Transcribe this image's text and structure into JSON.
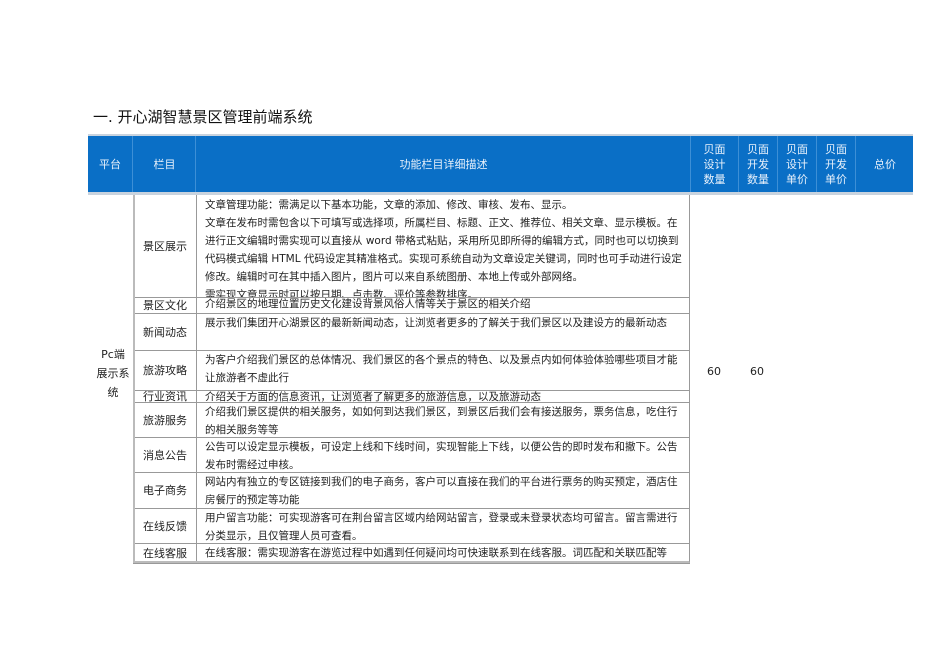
{
  "title": "一. 开心湖智慧景区管理前端系统",
  "header": [
    "平台",
    "栏目",
    "功能栏目详细描述",
    "贝面设计数量",
    "贝面开发数量",
    "贝面设计单价",
    "贝面开发单价",
    "总价"
  ],
  "platform": "Pc端展示系统",
  "design_qty": "60",
  "dev_qty": "60",
  "rows": [
    {
      "cat": "景区展示",
      "desc": "文章管理功能：需满足以下基本功能，文章的添加、修改、审核、发布、显示。\n文章在发布时需包含以下可填写或选择项，所属栏目、标题、正文、推荐位、相关文章、显示模板。在进行正文编辑时需实现可以直接从 word 带格式粘贴，采用所见即所得的编辑方式，同时也可以切换到代码模式编辑 HTML 代码设定其精准格式。实现可系统自动为文章设定关键词，同时也可手动进行设定修改。编辑时可在其中插入图片，图片可以来自系统图册、本地上传或外部网络。\n需实现文章显示时可以按日期、点击数、评价等参数排序。"
    },
    {
      "cat": "景区文化",
      "desc": "介绍景区的地理位置历史文化建设背景风俗人情等关于景区的相关介绍"
    },
    {
      "cat": "新闻动态",
      "desc": "展示我们集团开心湖景区的最新新闻动态，让浏览者更多的了解关于我们景区以及建设方的最新动态"
    },
    {
      "cat": "旅游攻略",
      "desc": "为客户介绍我们景区的总体情况、我们景区的各个景点的特色、以及景点内如何体验体验哪些项目才能让旅游者不虚此行"
    },
    {
      "cat": "行业资讯",
      "desc": "介绍关于方面的信息资讯，让浏览者了解更多的旅游信息，以及旅游动态"
    },
    {
      "cat": "旅游服务",
      "desc": "介绍我们景区提供的相关服务，如如何到达我们景区，到景区后我们会有接送服务，票务信息，吃住行的相关服务等等"
    },
    {
      "cat": "消息公告",
      "desc": "公告可以设定显示模板，可设定上线和下线时间，实现智能上下线，以便公告的即时发布和撤下。公告发布时需经过申核。"
    },
    {
      "cat": "电子商务",
      "desc": "网站内有独立的专区链接到我们的电子商务，客户可以直接在我们的平台进行票务的购买预定，酒店住房餐厅的预定等功能"
    },
    {
      "cat": "在线反馈",
      "desc": "用户留言功能：可实现游客可在荆台留言区域内给网站留言，登录或未登录状态均可留言。留言需进行分类显示，且仅管理人员可查看。"
    },
    {
      "cat": "在线客服",
      "desc": "在线客服：需实现游客在游览过程中如遇到任何疑问均可快速联系到在线客服。词匹配和关联匹配等"
    }
  ]
}
